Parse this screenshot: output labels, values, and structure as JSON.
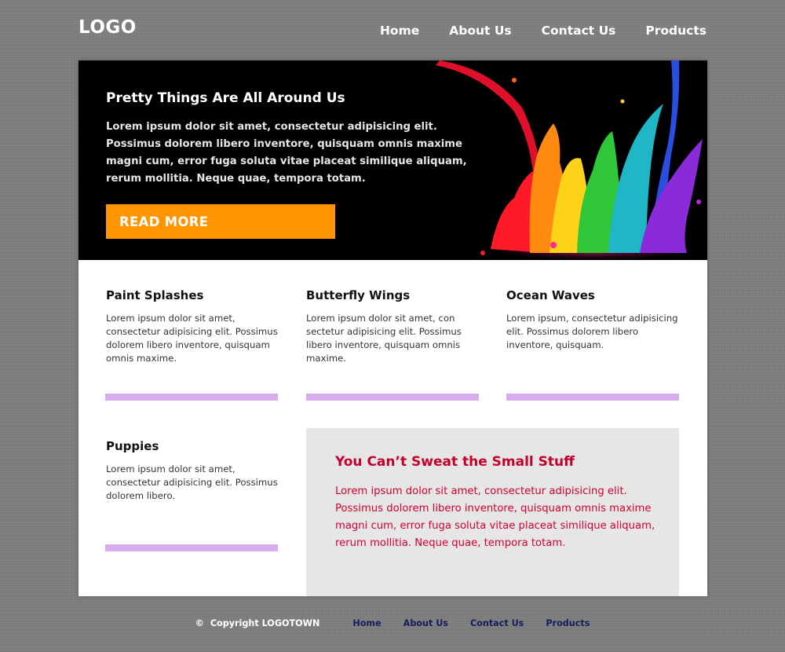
{
  "header": {
    "logo": "LOGO",
    "nav": [
      "Home",
      "About Us",
      "Contact Us",
      "Products"
    ]
  },
  "hero": {
    "title": "Pretty Things Are All Around Us",
    "text": "Lorem ipsum dolor sit amet, consectetur adipisicing elit. Possimus dolorem libero inventore, quisquam omnis maxime magni cum, error fuga soluta vitae placeat similique aliquam, rerum mollitia. Neque quae, tempora totam.",
    "button": "READ MORE"
  },
  "cards": [
    {
      "title": "Paint Splashes",
      "text": "Lorem ipsum dolor sit amet, consectetur adipisicing elit. Possimus dolorem libero inventore, quisquam omnis maxime."
    },
    {
      "title": "Butterfly Wings",
      "text": "Lorem ipsum dolor sit amet, con sectetur adipisicing elit. Possimus libero inventore, quisquam omnis maxime."
    },
    {
      "title": "Ocean Waves",
      "text": "Lorem ipsum, consectetur adipisicing elit. Possimus dolorem libero inventore, quisquam."
    },
    {
      "title": "Puppies",
      "text": "Lorem ipsum dolor sit amet, consectetur adipisicing elit. Possimus dolorem libero."
    }
  ],
  "quote": {
    "title": "You Can’t Sweat the Small Stuff",
    "text": "Lorem ipsum dolor sit amet, consectetur adipisicing elit. Possimus dolorem libero inventore, quisquam omnis maxime magni cum, error fuga soluta vitae placeat similique aliquam, rerum mollitia. Neque quae, tempora totam."
  },
  "footer": {
    "copyright_symbol": "©",
    "copyright": "Copyright LOGOTOWN",
    "links": [
      "Home",
      "About Us",
      "Contact Us",
      "Products"
    ]
  },
  "colors": {
    "background": "#7f7f7f",
    "accent_orange": "#fd9400",
    "card_bar": "#d6acef",
    "quote_red": "#d40030",
    "footer_link": "#141e5c"
  }
}
